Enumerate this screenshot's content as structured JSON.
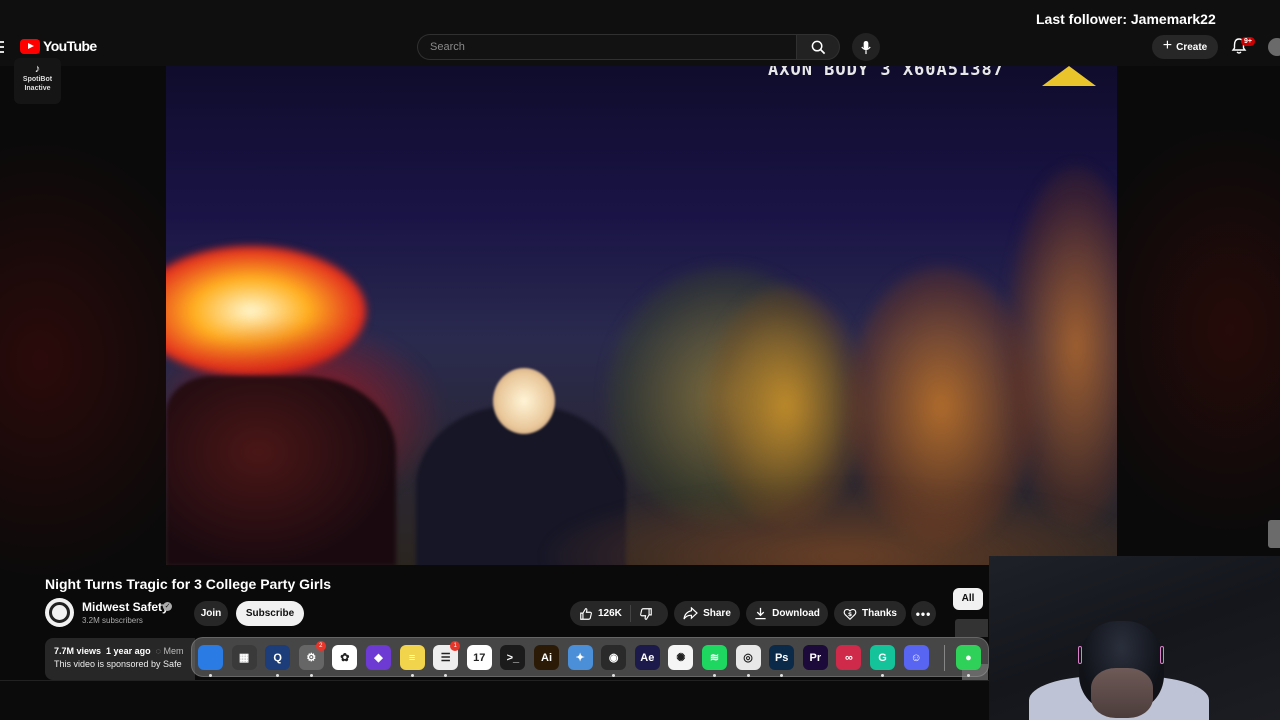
{
  "stream": {
    "last_follower": "Last follower: Jamemark22"
  },
  "header": {
    "logo_text": "YouTube",
    "search_placeholder": "Search",
    "create_label": "Create",
    "notifications_badge": "9+"
  },
  "spotibot": {
    "line1": "SpotiBot",
    "line2": "Inactive"
  },
  "video": {
    "overlay_text": "AXON BODY 3  X60A51387",
    "title": "Night Turns Tragic for 3 College Party Girls"
  },
  "channel": {
    "name": "Midwest Safety",
    "subscribers": "3.2M subscribers",
    "join_label": "Join",
    "subscribe_label": "Subscribe"
  },
  "actions": {
    "likes": "126K",
    "share": "Share",
    "download": "Download",
    "thanks": "Thanks",
    "more": "•••"
  },
  "filter_chip": "All",
  "description": {
    "views": "7.7M views",
    "age": "1 year ago",
    "members": "Mem",
    "text": "This video is sponsored by Safe"
  },
  "dock": {
    "apps": [
      {
        "name": "finder",
        "label": "",
        "bg": "#2a7be4",
        "glyph": ""
      },
      {
        "name": "launchpad",
        "label": "",
        "bg": "#3a3a3a",
        "glyph": "▦"
      },
      {
        "name": "quicktime",
        "label": "",
        "bg": "#1c3d7a",
        "glyph": "Q"
      },
      {
        "name": "system-settings",
        "label": "",
        "bg": "#666",
        "glyph": "⚙",
        "badge": "2"
      },
      {
        "name": "photos",
        "label": "",
        "bg": "#ffffff",
        "glyph": "✿"
      },
      {
        "name": "obsidian",
        "label": "",
        "bg": "#6d3bd4",
        "glyph": "◆"
      },
      {
        "name": "notes",
        "label": "",
        "bg": "#f2d34c",
        "glyph": "≡"
      },
      {
        "name": "reminders",
        "label": "",
        "bg": "#eeeeee",
        "glyph": "☰",
        "badge": "1"
      },
      {
        "name": "calendar",
        "label": "17",
        "bg": "#ffffff",
        "glyph": ""
      },
      {
        "name": "terminal",
        "label": "",
        "bg": "#1b1b1b",
        "glyph": ">_"
      },
      {
        "name": "illustrator",
        "label": "Ai",
        "bg": "#2b1a05",
        "glyph": ""
      },
      {
        "name": "xcode-sim",
        "label": "",
        "bg": "#4a8fd8",
        "glyph": "✦"
      },
      {
        "name": "obs",
        "label": "",
        "bg": "#2a2a2a",
        "glyph": "◉"
      },
      {
        "name": "after-effects",
        "label": "Ae",
        "bg": "#1b1a4a",
        "glyph": ""
      },
      {
        "name": "chatgpt",
        "label": "",
        "bg": "#f5f5f5",
        "glyph": "✺"
      },
      {
        "name": "spotify",
        "label": "",
        "bg": "#1ed760",
        "glyph": "≋"
      },
      {
        "name": "chrome",
        "label": "",
        "bg": "#e8e8e8",
        "glyph": "◎"
      },
      {
        "name": "photoshop",
        "label": "Ps",
        "bg": "#0b2a4a",
        "glyph": ""
      },
      {
        "name": "premiere",
        "label": "Pr",
        "bg": "#1b0a3a",
        "glyph": ""
      },
      {
        "name": "creative-cloud",
        "label": "",
        "bg": "#d02a4a",
        "glyph": "∞"
      },
      {
        "name": "grammarly",
        "label": "",
        "bg": "#15c39a",
        "glyph": "G"
      },
      {
        "name": "discord",
        "label": "",
        "bg": "#5865f2",
        "glyph": "☺"
      },
      {
        "name": "messages",
        "label": "",
        "bg": "#30d158",
        "glyph": "●"
      }
    ]
  }
}
